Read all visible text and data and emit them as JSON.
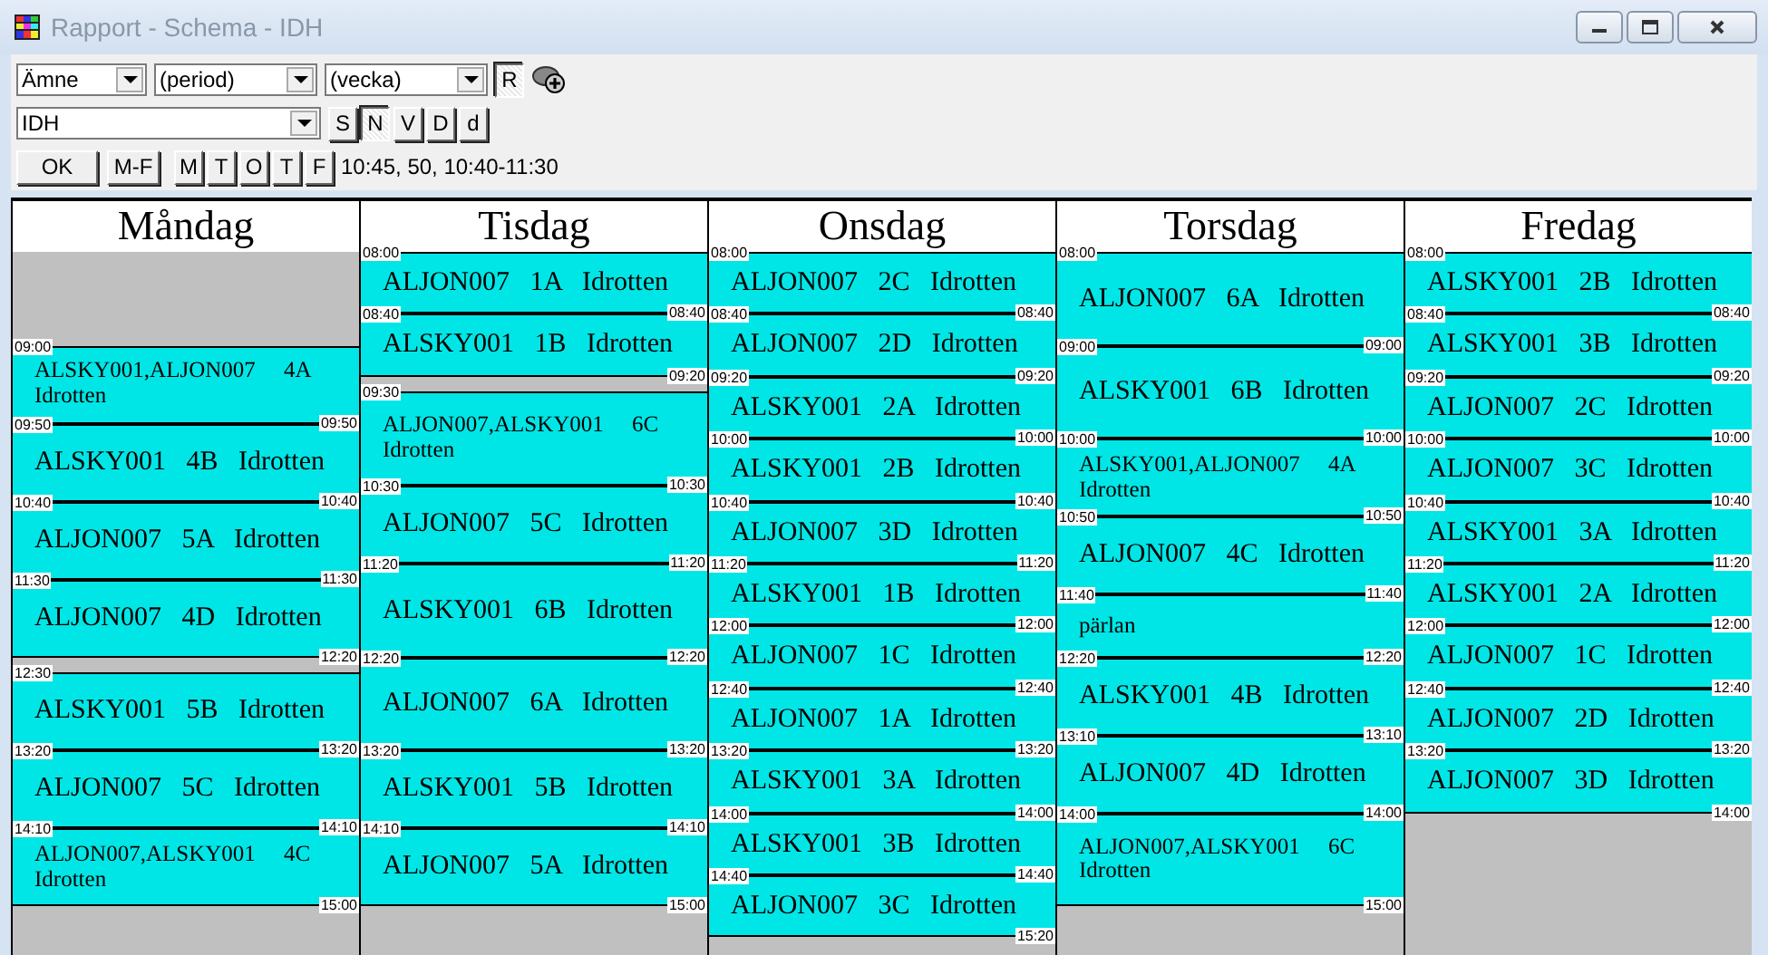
{
  "window": {
    "title": "Rapport - Schema - IDH"
  },
  "toolbar": {
    "filters": [
      {
        "value": "Ämne"
      },
      {
        "value": "(period)"
      },
      {
        "value": "(vecka)"
      }
    ],
    "r_toggle": {
      "label": "R",
      "selected": true
    },
    "group_select": {
      "value": "IDH"
    },
    "view_buttons": [
      {
        "label": "S",
        "selected": false
      },
      {
        "label": "N",
        "selected": true
      },
      {
        "label": "V",
        "selected": false
      },
      {
        "label": "D",
        "selected": false
      },
      {
        "label": "d",
        "selected": false
      }
    ],
    "ok_button": "OK",
    "range_button": "M-F",
    "day_buttons": [
      "M",
      "T",
      "O",
      "T",
      "F"
    ],
    "info": "10:45, 50, 10:40-11:30"
  },
  "days": [
    {
      "name": "Måndag",
      "lessons": [
        {
          "start": "09:00",
          "end": "09:50",
          "kind": "pair",
          "text": "ALSKY001,ALJON007     4A Idrotten"
        },
        {
          "start": "09:50",
          "end": "10:40",
          "kind": "single",
          "text": "ALSKY001   4B   Idrotten"
        },
        {
          "start": "10:40",
          "end": "11:30",
          "kind": "single",
          "text": "ALJON007   5A   Idrotten"
        },
        {
          "start": "11:30",
          "end": "12:20",
          "kind": "single",
          "text": "ALJON007   4D   Idrotten"
        },
        {
          "start": "12:30",
          "end": "13:20",
          "kind": "single",
          "text": "ALSKY001   5B   Idrotten"
        },
        {
          "start": "13:20",
          "end": "14:10",
          "kind": "single",
          "text": "ALJON007   5C   Idrotten"
        },
        {
          "start": "14:10",
          "end": "15:00",
          "kind": "pair",
          "text": "ALJON007,ALSKY001     4C Idrotten"
        }
      ]
    },
    {
      "name": "Tisdag",
      "lessons": [
        {
          "start": "08:00",
          "end": "08:40",
          "kind": "single",
          "text": "ALJON007   1A   Idrotten"
        },
        {
          "start": "08:40",
          "end": "09:20",
          "kind": "single",
          "text": "ALSKY001   1B   Idrotten"
        },
        {
          "start": "09:30",
          "end": "10:30",
          "kind": "pair",
          "text": "ALJON007,ALSKY001     6C Idrotten"
        },
        {
          "start": "10:30",
          "end": "11:20",
          "kind": "single",
          "text": "ALJON007   5C   Idrotten"
        },
        {
          "start": "11:20",
          "end": "12:20",
          "kind": "single",
          "text": "ALSKY001   6B   Idrotten"
        },
        {
          "start": "12:20",
          "end": "13:20",
          "kind": "single",
          "text": "ALJON007   6A   Idrotten"
        },
        {
          "start": "13:20",
          "end": "14:10",
          "kind": "single",
          "text": "ALSKY001   5B   Idrotten"
        },
        {
          "start": "14:10",
          "end": "15:00",
          "kind": "single",
          "text": "ALJON007   5A   Idrotten"
        }
      ]
    },
    {
      "name": "Onsdag",
      "lessons": [
        {
          "start": "08:00",
          "end": "08:40",
          "kind": "single",
          "text": "ALJON007   2C   Idrotten"
        },
        {
          "start": "08:40",
          "end": "09:20",
          "kind": "single",
          "text": "ALJON007   2D   Idrotten"
        },
        {
          "start": "09:20",
          "end": "10:00",
          "kind": "single",
          "text": "ALSKY001   2A   Idrotten"
        },
        {
          "start": "10:00",
          "end": "10:40",
          "kind": "single",
          "text": "ALSKY001   2B   Idrotten"
        },
        {
          "start": "10:40",
          "end": "11:20",
          "kind": "single",
          "text": "ALJON007   3D   Idrotten"
        },
        {
          "start": "11:20",
          "end": "12:00",
          "kind": "single",
          "text": "ALSKY001   1B   Idrotten"
        },
        {
          "start": "12:00",
          "end": "12:40",
          "kind": "single",
          "text": "ALJON007   1C   Idrotten"
        },
        {
          "start": "12:40",
          "end": "13:20",
          "kind": "single",
          "text": "ALJON007   1A   Idrotten"
        },
        {
          "start": "13:20",
          "end": "14:00",
          "kind": "single",
          "text": "ALSKY001   3A   Idrotten"
        },
        {
          "start": "14:00",
          "end": "14:40",
          "kind": "single",
          "text": "ALSKY001   3B   Idrotten"
        },
        {
          "start": "14:40",
          "end": "15:20",
          "kind": "single",
          "text": "ALJON007   3C   Idrotten"
        }
      ]
    },
    {
      "name": "Torsdag",
      "lessons": [
        {
          "start": "08:00",
          "end": "09:00",
          "kind": "single",
          "text": "ALJON007   6A   Idrotten"
        },
        {
          "start": "09:00",
          "end": "10:00",
          "kind": "single",
          "text": "ALSKY001   6B   Idrotten"
        },
        {
          "start": "10:00",
          "end": "10:50",
          "kind": "pair",
          "text": "ALSKY001,ALJON007     4A Idrotten"
        },
        {
          "start": "10:50",
          "end": "11:40",
          "kind": "single",
          "text": "ALJON007   4C   Idrotten"
        },
        {
          "start": "11:40",
          "end": "12:20",
          "kind": "pair",
          "text": "pärlan"
        },
        {
          "start": "12:20",
          "end": "13:10",
          "kind": "single",
          "text": "ALSKY001   4B   Idrotten"
        },
        {
          "start": "13:10",
          "end": "14:00",
          "kind": "single",
          "text": "ALJON007   4D   Idrotten"
        },
        {
          "start": "14:00",
          "end": "15:00",
          "kind": "pair",
          "text": "ALJON007,ALSKY001     6C Idrotten"
        }
      ]
    },
    {
      "name": "Fredag",
      "lessons": [
        {
          "start": "08:00",
          "end": "08:40",
          "kind": "single",
          "text": "ALSKY001   2B   Idrotten"
        },
        {
          "start": "08:40",
          "end": "09:20",
          "kind": "single",
          "text": "ALSKY001   3B   Idrotten"
        },
        {
          "start": "09:20",
          "end": "10:00",
          "kind": "single",
          "text": "ALJON007   2C   Idrotten"
        },
        {
          "start": "10:00",
          "end": "10:40",
          "kind": "single",
          "text": "ALJON007   3C   Idrotten"
        },
        {
          "start": "10:40",
          "end": "11:20",
          "kind": "single",
          "text": "ALSKY001   3A   Idrotten"
        },
        {
          "start": "11:20",
          "end": "12:00",
          "kind": "single",
          "text": "ALSKY001   2A   Idrotten"
        },
        {
          "start": "12:00",
          "end": "12:40",
          "kind": "single",
          "text": "ALJON007   1C   Idrotten"
        },
        {
          "start": "12:40",
          "end": "13:20",
          "kind": "single",
          "text": "ALJON007   2D   Idrotten"
        },
        {
          "start": "13:20",
          "end": "14:00",
          "kind": "single",
          "text": "ALJON007   3D   Idrotten"
        }
      ]
    }
  ]
}
